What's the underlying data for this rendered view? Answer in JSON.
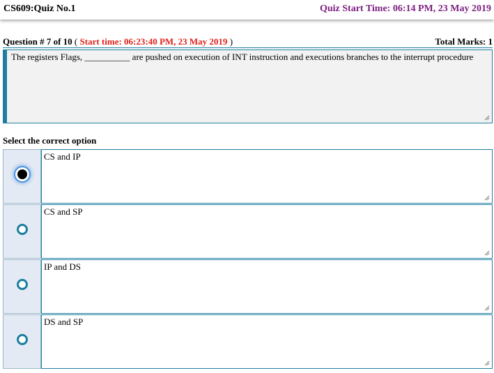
{
  "header": {
    "course_title": "CS609:Quiz No.1",
    "quiz_start": "Quiz Start Time: 06:14 PM, 23 May 2019"
  },
  "question": {
    "number_label": "Question # 7 of 10",
    "open_paren": " ( ",
    "start_time": "Start time: 06:23:40 PM, 23 May 2019",
    "close_paren": " )",
    "total_marks": "Total Marks: 1",
    "text": "The registers Flags, __________ are pushed on execution of INT instruction and executions branches to the interrupt procedure"
  },
  "select_label": "Select the correct option",
  "options": [
    {
      "label": "CS and IP",
      "selected": true
    },
    {
      "label": "CS and SP",
      "selected": false
    },
    {
      "label": "IP and DS",
      "selected": false
    },
    {
      "label": "DS and SP",
      "selected": false
    }
  ],
  "colors": {
    "accent": "#1d7ea0",
    "quiz_start": "#7b1f7f",
    "start_time": "#e0211b"
  }
}
